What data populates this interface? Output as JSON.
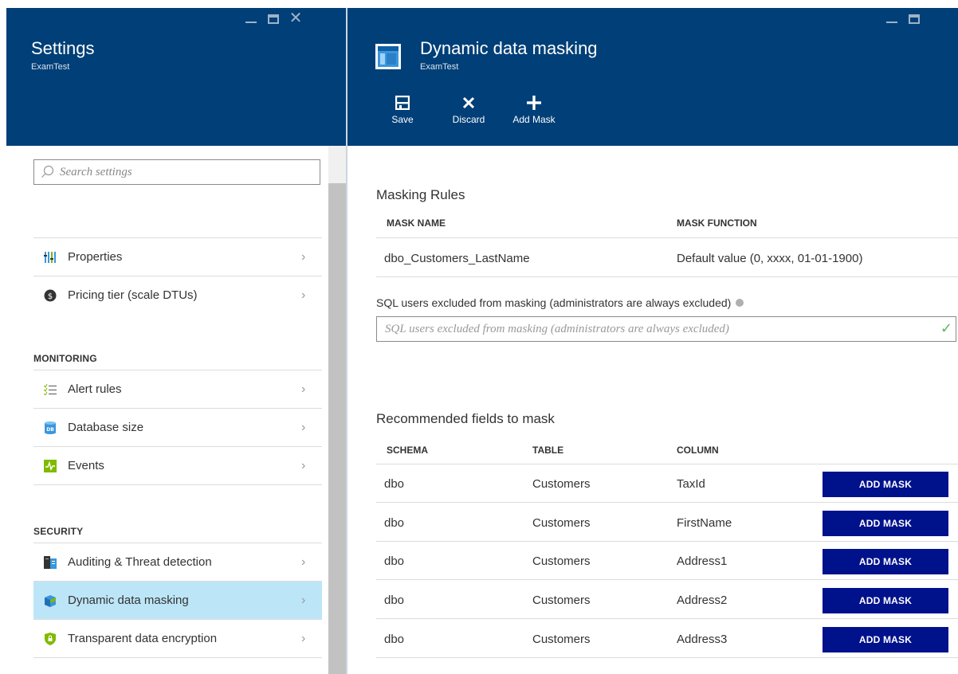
{
  "left_blade": {
    "title": "Settings",
    "subtitle": "ExamTest",
    "search_placeholder": "Search settings",
    "items_general": [
      {
        "label": "Properties",
        "icon": "properties-icon"
      },
      {
        "label": "Pricing tier (scale DTUs)",
        "icon": "pricing-tier-icon"
      }
    ],
    "monitoring_heading": "MONITORING",
    "items_monitoring": [
      {
        "label": "Alert rules",
        "icon": "alert-rules-icon"
      },
      {
        "label": "Database size",
        "icon": "database-size-icon"
      },
      {
        "label": "Events",
        "icon": "events-icon"
      }
    ],
    "security_heading": "SECURITY",
    "items_security": [
      {
        "label": "Auditing & Threat detection",
        "icon": "auditing-icon"
      },
      {
        "label": "Dynamic data masking",
        "icon": "data-masking-icon",
        "active": true
      },
      {
        "label": "Transparent data encryption",
        "icon": "encryption-shield-icon"
      }
    ],
    "chevron": "›"
  },
  "right_blade": {
    "title": "Dynamic data masking",
    "subtitle": "ExamTest",
    "commands": {
      "save": "Save",
      "discard": "Discard",
      "add_mask": "Add Mask"
    },
    "masking_rules": {
      "title": "Masking Rules",
      "headers": [
        "MASK NAME",
        "MASK FUNCTION"
      ],
      "rows": [
        {
          "name": "dbo_Customers_LastName",
          "function": "Default value (0, xxxx, 01-01-1900)"
        }
      ]
    },
    "excluded_users": {
      "label": "SQL users excluded from masking (administrators are always excluded)",
      "placeholder": "SQL users excluded from masking (administrators are always excluded)"
    },
    "recommended": {
      "title": "Recommended fields to mask",
      "headers": [
        "SCHEMA",
        "TABLE",
        "COLUMN"
      ],
      "button_label": "ADD MASK",
      "rows": [
        {
          "schema": "dbo",
          "table": "Customers",
          "column": "TaxId"
        },
        {
          "schema": "dbo",
          "table": "Customers",
          "column": "FirstName"
        },
        {
          "schema": "dbo",
          "table": "Customers",
          "column": "Address1"
        },
        {
          "schema": "dbo",
          "table": "Customers",
          "column": "Address2"
        },
        {
          "schema": "dbo",
          "table": "Customers",
          "column": "Address3"
        }
      ]
    }
  },
  "colors": {
    "header_bg": "#003f77",
    "active_item_bg": "#bce6f7",
    "add_mask_button": "#00118c",
    "valid_check": "#5cb85c"
  }
}
